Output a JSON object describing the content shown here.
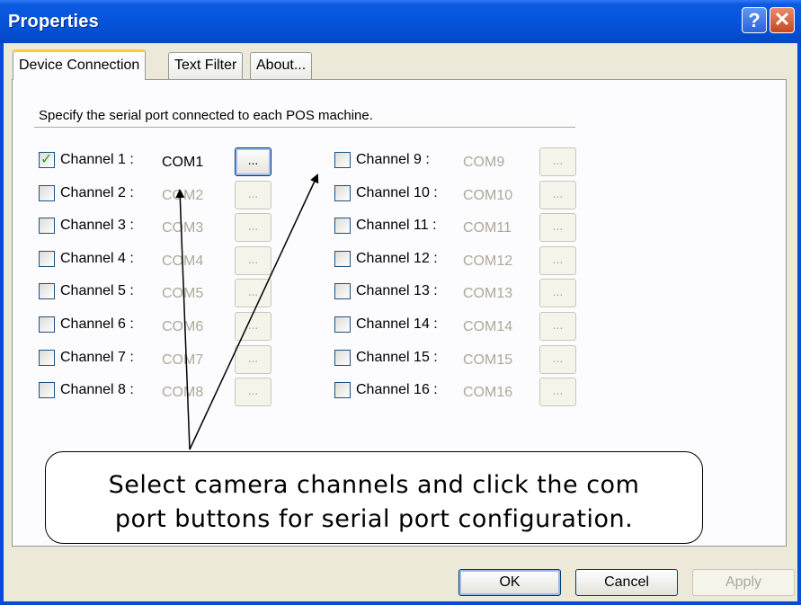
{
  "window": {
    "title": "Properties",
    "help_glyph": "?",
    "close_glyph": "✕"
  },
  "tabs": [
    {
      "label": "Device Connection",
      "active": true
    },
    {
      "label": "Text Filter",
      "active": false
    },
    {
      "label": "About...",
      "active": false
    }
  ],
  "instruction": "Specify the serial port connected to each POS machine.",
  "channels": [
    {
      "label": "Channel 1 :",
      "port": "COM1",
      "checked": true
    },
    {
      "label": "Channel 2 :",
      "port": "COM2",
      "checked": false
    },
    {
      "label": "Channel 3 :",
      "port": "COM3",
      "checked": false
    },
    {
      "label": "Channel 4 :",
      "port": "COM4",
      "checked": false
    },
    {
      "label": "Channel 5 :",
      "port": "COM5",
      "checked": false
    },
    {
      "label": "Channel 6 :",
      "port": "COM6",
      "checked": false
    },
    {
      "label": "Channel 7 :",
      "port": "COM7",
      "checked": false
    },
    {
      "label": "Channel 8 :",
      "port": "COM8",
      "checked": false
    },
    {
      "label": "Channel 9 :",
      "port": "COM9",
      "checked": false
    },
    {
      "label": "Channel 10 :",
      "port": "COM10",
      "checked": false
    },
    {
      "label": "Channel 11 :",
      "port": "COM11",
      "checked": false
    },
    {
      "label": "Channel 12 :",
      "port": "COM12",
      "checked": false
    },
    {
      "label": "Channel 13 :",
      "port": "COM13",
      "checked": false
    },
    {
      "label": "Channel 14 :",
      "port": "COM14",
      "checked": false
    },
    {
      "label": "Channel 15 :",
      "port": "COM15",
      "checked": false
    },
    {
      "label": "Channel 16 :",
      "port": "COM16",
      "checked": false
    }
  ],
  "browse_label": "...",
  "callout": {
    "line1": "Select camera channels and click the com",
    "line2": "port buttons for serial port configuration."
  },
  "buttons": {
    "ok": "OK",
    "cancel": "Cancel",
    "apply": "Apply"
  }
}
